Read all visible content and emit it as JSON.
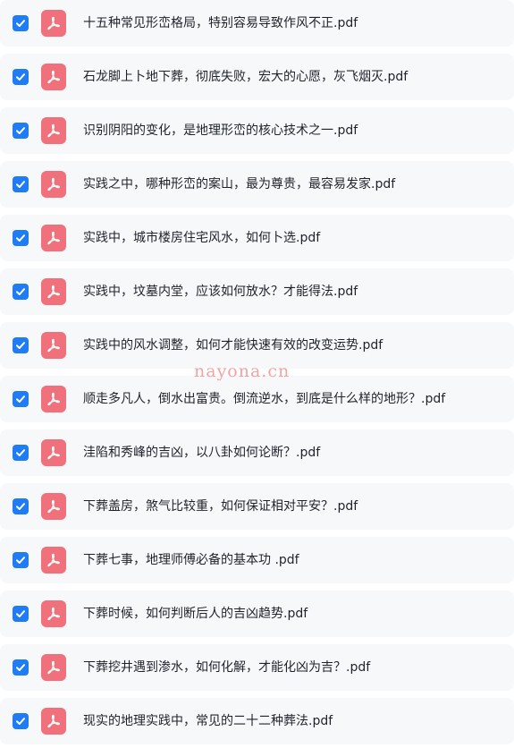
{
  "colors": {
    "checkbox": "#1f7cf5",
    "pdf_icon": "#f0707c",
    "row_bg": "#f7f8fa",
    "text": "#1f2329",
    "watermark": "#f2a3a3"
  },
  "icons": {
    "checkbox": "checkmark-icon",
    "file": "pdf-file-icon"
  },
  "files": [
    {
      "name": "十五种常见形峦格局，特别容易导致作风不正.pdf",
      "checked": true
    },
    {
      "name": "石龙脚上卜地下葬，彻底失败，宏大的心愿，灰飞烟灭.pdf",
      "checked": true
    },
    {
      "name": "识别阴阳的变化，是地理形峦的核心技术之一.pdf",
      "checked": true
    },
    {
      "name": "实践之中，哪种形峦的案山，最为尊贵，最容易发家.pdf",
      "checked": true
    },
    {
      "name": "实践中，城市楼房住宅风水，如何卜选.pdf",
      "checked": true
    },
    {
      "name": "实践中，坟墓内堂，应该如何放水？才能得法.pdf",
      "checked": true
    },
    {
      "name": "实践中的风水调整，如何才能快速有效的改变运势.pdf",
      "checked": true
    },
    {
      "name": "顺走多凡人，倒水出富贵。倒流逆水，到底是什么样的地形？.pdf",
      "checked": true
    },
    {
      "name": "洼陷和秀峰的吉凶，以八卦如何论断？.pdf",
      "checked": true
    },
    {
      "name": "下葬盖房，煞气比较重，如何保证相对平安？.pdf",
      "checked": true
    },
    {
      "name": "下葬七事，地理师傅必备的基本功 .pdf",
      "checked": true
    },
    {
      "name": "下葬时候，如何判断后人的吉凶趋势.pdf",
      "checked": true
    },
    {
      "name": "下葬挖井遇到渗水，如何化解，才能化凶为吉？.pdf",
      "checked": true
    },
    {
      "name": "现实的地理实践中，常见的二十二种葬法.pdf",
      "checked": true
    }
  ],
  "watermark": "nayona.cn"
}
